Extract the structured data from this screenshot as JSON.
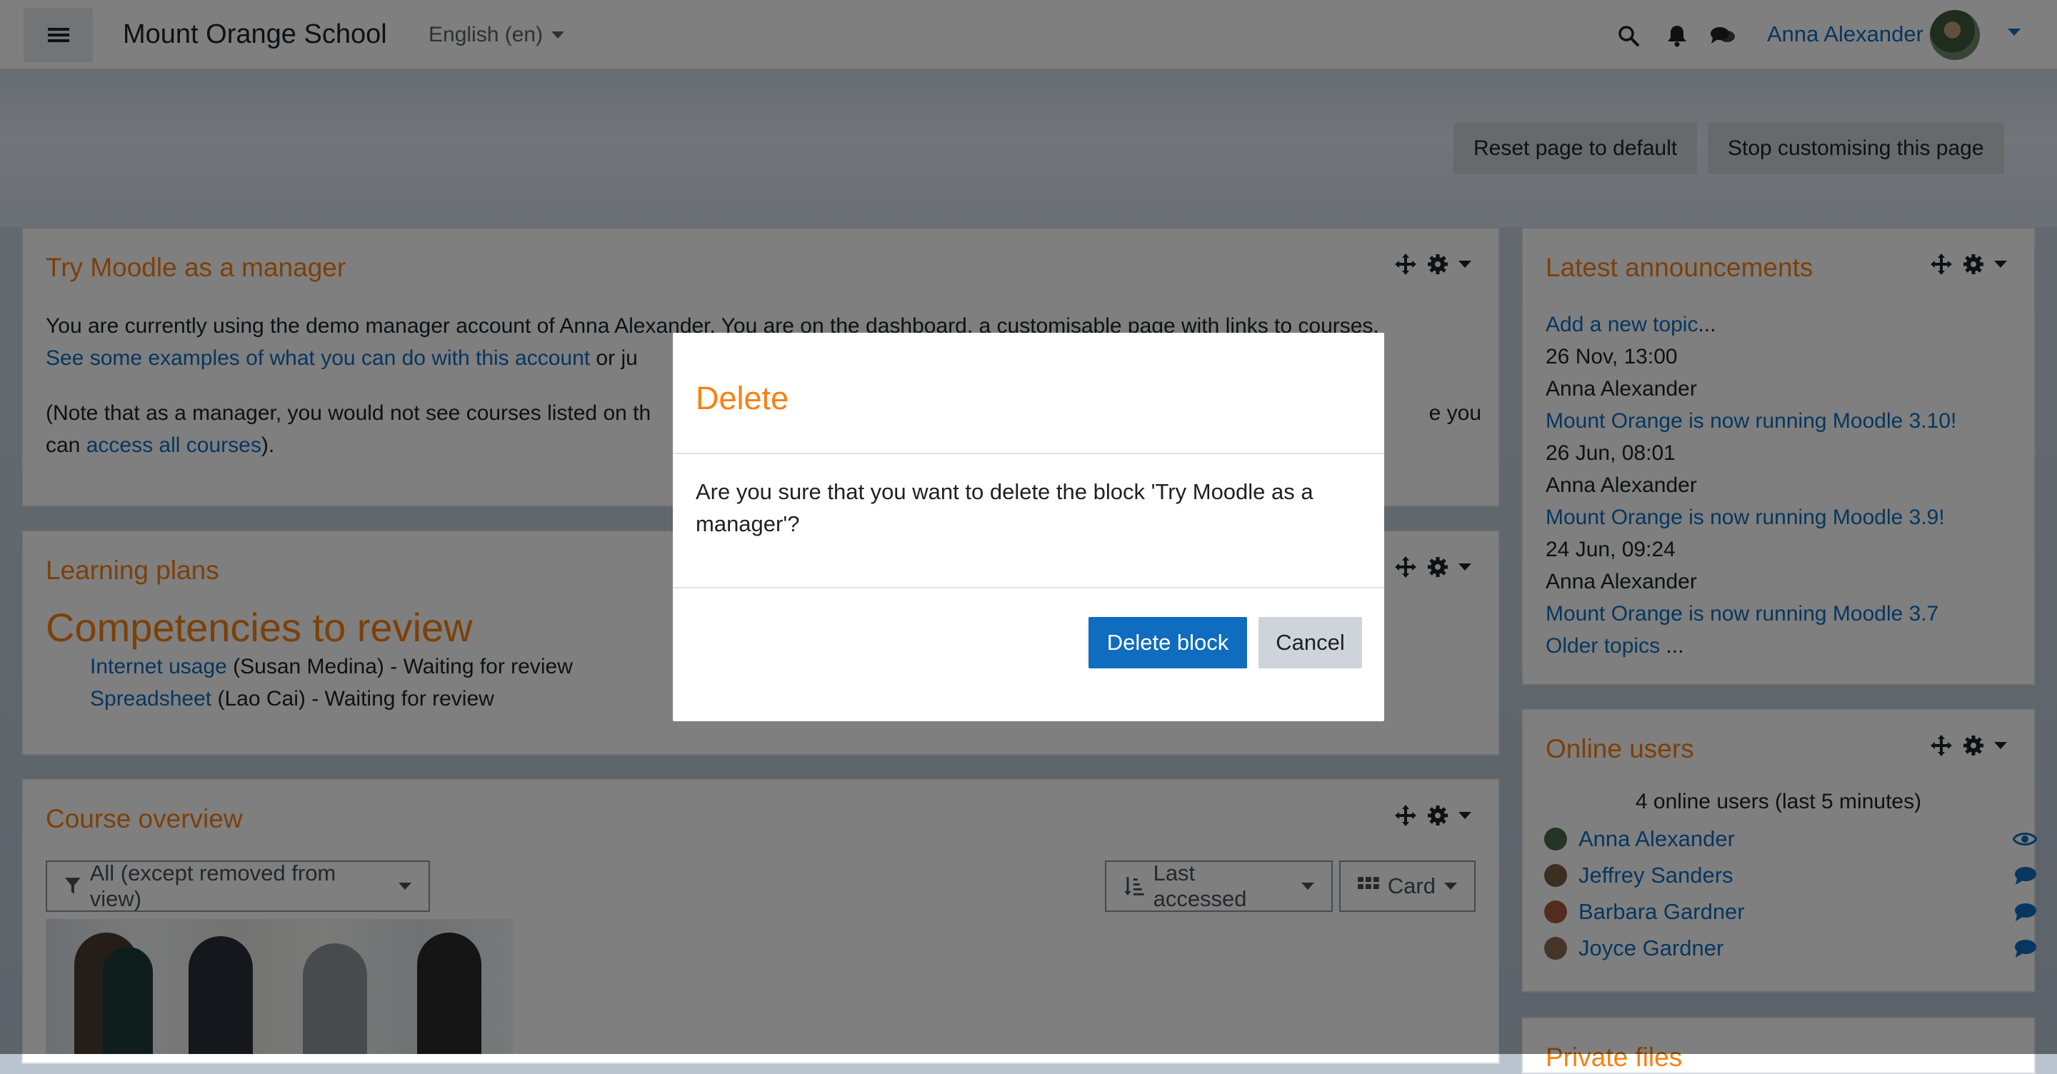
{
  "navbar": {
    "site_name": "Mount Orange School",
    "language": "English (en)",
    "user_name": "Anna Alexander"
  },
  "header": {
    "reset_label": "Reset page to default",
    "stop_label": "Stop customising this page"
  },
  "blocks": {
    "try_moodle": {
      "title": "Try Moodle as a manager",
      "line1": "You are currently using the demo manager account of Anna Alexander. You are on the dashboard, a customisable page with links to courses.",
      "link1": "See some examples of what you can do with this account",
      "line2_rest": " or ju",
      "line3_start": "(Note that as a manager, you would not see courses listed on th",
      "line3_end": "e you",
      "line4_start": "can ",
      "link2": "access all courses",
      "line4_end": ")."
    },
    "learning_plans": {
      "title": "Learning plans",
      "heading": "Competencies to review",
      "items": [
        {
          "link": "Internet usage",
          "text": " (Susan Medina) - Waiting for review"
        },
        {
          "link": "Spreadsheet",
          "text": " (Lao Cai) - Waiting for review"
        }
      ]
    },
    "course_overview": {
      "title": "Course overview",
      "filter": "All (except removed from view)",
      "sort": "Last accessed",
      "view": "Card"
    },
    "announcements": {
      "title": "Latest announcements",
      "add_topic": "Add a new topic",
      "add_topic_suffix": "...",
      "posts": [
        {
          "date": "26 Nov, 13:00",
          "author": "Anna Alexander",
          "title": "Mount Orange is now running Moodle 3.10!"
        },
        {
          "date": "26 Jun, 08:01",
          "author": "Anna Alexander",
          "title": "Mount Orange is now running Moodle 3.9!"
        },
        {
          "date": "24 Jun, 09:24",
          "author": "Anna Alexander",
          "title": "Mount Orange is now running Moodle 3.7"
        }
      ],
      "older": "Older topics",
      "older_suffix": " ..."
    },
    "online_users": {
      "title": "Online users",
      "summary": "4 online users (last 5 minutes)",
      "users": [
        "Anna Alexander",
        "Jeffrey Sanders",
        "Barbara Gardner",
        "Joyce Gardner"
      ]
    },
    "private_files": {
      "title": "Private files"
    }
  },
  "modal": {
    "title": "Delete",
    "body": "Are you sure that you want to delete the block 'Try Moodle as a manager'?",
    "confirm_label": "Delete block",
    "cancel_label": "Cancel"
  },
  "colors": {
    "accent": "#f98012",
    "link": "#0f6cbf",
    "primary_button": "#0f6cbf",
    "secondary_button": "#ced4da"
  }
}
